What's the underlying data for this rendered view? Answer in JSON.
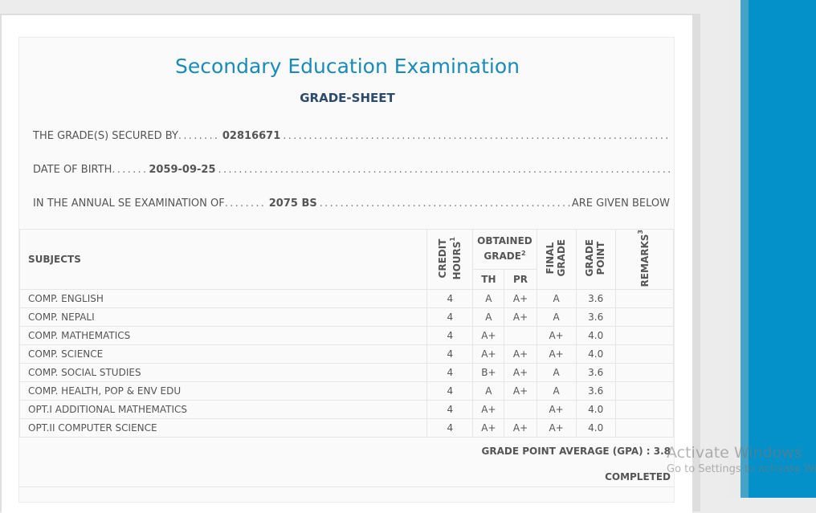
{
  "title": "Secondary Education Examination",
  "subtitle": "GRADE-SHEET",
  "info": {
    "secured_label": "THE GRADE(S) SECURED BY",
    "secured_value": "02816671",
    "dob_label": "DATE OF BIRTH",
    "dob_value": "2059-09-25",
    "exam_label": "IN THE ANNUAL SE EXAMINATION OF",
    "exam_value": "2075 BS",
    "exam_tail": "ARE GIVEN BELOW"
  },
  "table": {
    "headers": {
      "subjects": "SUBJECTS",
      "credit_hours_line1": "CREDIT",
      "credit_hours_line2": "HOURS",
      "credit_sup": "1",
      "obtained_grade_line1": "OBTAINED",
      "obtained_grade_line2": "GRADE",
      "obtained_sup": "2",
      "th": "TH",
      "pr": "PR",
      "final_line1": "FINAL",
      "final_line2": "GRADE",
      "gp_line1": "GRADE",
      "gp_line2": "POINT",
      "remarks": "REMARKS",
      "remarks_sup": "3"
    },
    "rows": [
      {
        "subject": "COMP. ENGLISH",
        "credit": "4",
        "th": "A",
        "pr": "A+",
        "final": "A",
        "gp": "3.6",
        "remarks": ""
      },
      {
        "subject": "COMP. NEPALI",
        "credit": "4",
        "th": "A",
        "pr": "A+",
        "final": "A",
        "gp": "3.6",
        "remarks": ""
      },
      {
        "subject": "COMP. MATHEMATICS",
        "credit": "4",
        "th": "A+",
        "pr": "",
        "final": "A+",
        "gp": "4.0",
        "remarks": ""
      },
      {
        "subject": "COMP. SCIENCE",
        "credit": "4",
        "th": "A+",
        "pr": "A+",
        "final": "A+",
        "gp": "4.0",
        "remarks": ""
      },
      {
        "subject": "COMP. SOCIAL STUDIES",
        "credit": "4",
        "th": "B+",
        "pr": "A+",
        "final": "A",
        "gp": "3.6",
        "remarks": ""
      },
      {
        "subject": "COMP. HEALTH, POP & ENV EDU",
        "credit": "4",
        "th": "A",
        "pr": "A+",
        "final": "A",
        "gp": "3.6",
        "remarks": ""
      },
      {
        "subject": "OPT.I ADDITIONAL MATHEMATICS",
        "credit": "4",
        "th": "A+",
        "pr": "",
        "final": "A+",
        "gp": "4.0",
        "remarks": ""
      },
      {
        "subject": "OPT.II COMPUTER SCIENCE",
        "credit": "4",
        "th": "A+",
        "pr": "A+",
        "final": "A+",
        "gp": "4.0",
        "remarks": ""
      }
    ]
  },
  "gpa_label": "GRADE POINT AVERAGE (GPA) : 3.8",
  "completed_label": "COMPLETED",
  "watermark": {
    "line1": "Activate Windows",
    "line2": "Go to Settings to activate Windows."
  }
}
